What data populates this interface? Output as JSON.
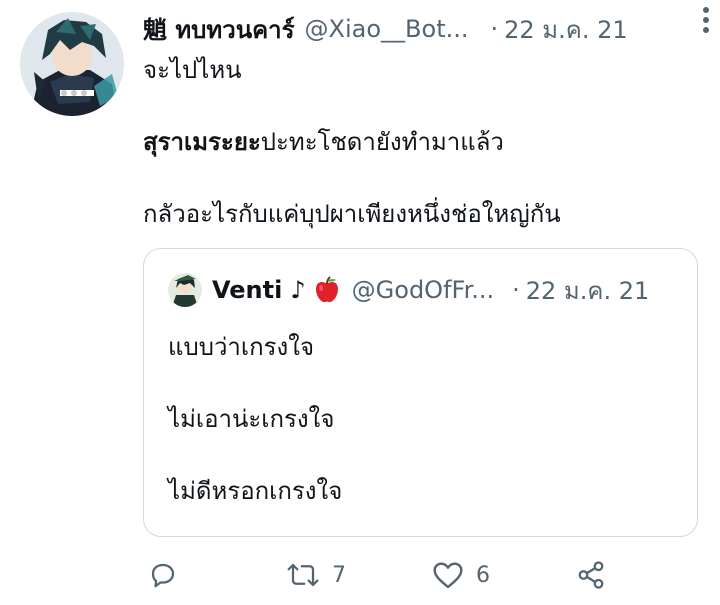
{
  "tweet": {
    "author_name": "魈 ทบทวนคาร์",
    "handle": "@Xiao__Bot...",
    "separator": "·",
    "date": "22 ม.ค. 21",
    "lines": [
      "จะไปไหน",
      "สุราเมระยะ",
      "ปะทะโชดายังทำมาแล้ว",
      "กลัวอะไรกับแค่บุปผาเพียงหนึ่งช่อใหญ่กัน"
    ]
  },
  "quote": {
    "author_name": "Venti",
    "name_symbol": "♪",
    "handle": "@GodOfFr...",
    "separator": "·",
    "date": "22 ม.ค. 21",
    "lines": [
      "แบบว่าเกรงใจ",
      "ไม่เอาน่ะเกรงใจ",
      "ไม่ดีหรอกเกรงใจ"
    ]
  },
  "actions": {
    "reply_icon": "reply-icon",
    "retweet_icon": "retweet-icon",
    "retweet_count": "7",
    "like_icon": "heart-icon",
    "like_count": "6",
    "share_icon": "share-icon"
  },
  "colors": {
    "text": "#0f1419",
    "secondary": "#536471",
    "border": "#cfd9de",
    "apple": "#e0202b"
  }
}
